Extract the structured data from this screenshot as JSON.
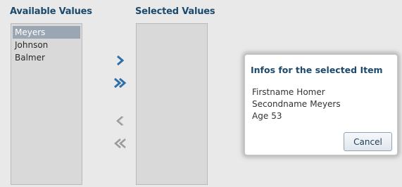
{
  "available": {
    "title": "Available Values",
    "items": [
      "Meyers",
      "Johnson",
      "Balmer"
    ],
    "selected_item": "Meyers"
  },
  "selected": {
    "title": "Selected Values",
    "items": []
  },
  "shuttle": {
    "move": "move-icon",
    "move_all": "move-all-icon",
    "remove": "remove-icon",
    "remove_all": "remove-all-icon"
  },
  "dialog": {
    "title": "Infos for the selected Item",
    "firstname_label": "Firstname",
    "firstname_value": "Homer",
    "secondname_label": "Secondname",
    "secondname_value": "Meyers",
    "age_label": "Age",
    "age_value": "53",
    "cancel_label": "Cancel"
  },
  "colors": {
    "accent": "#1c4a6e",
    "arrow_active": "#2f6fa8",
    "arrow_inactive": "#9a9a9a",
    "selection": "#9aa6b1"
  }
}
